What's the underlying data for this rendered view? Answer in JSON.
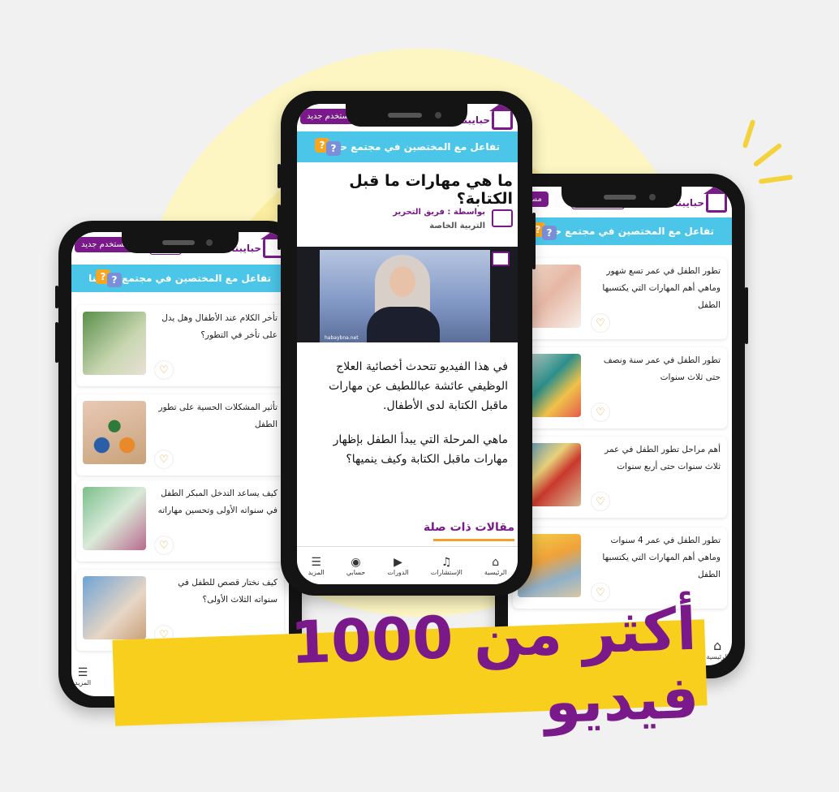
{
  "headline": "أكثر من 1000 فيديو",
  "brand": {
    "logo_text": "حبايبنا",
    "primary": "#7a1a8a",
    "accent": "#4cc6e8",
    "yellow": "#f9cf1e"
  },
  "top": {
    "new_user": "مستخدم جديد"
  },
  "banner": {
    "text": "تفاعل مع المختصين في مجتمع حبايبنا"
  },
  "left_phone": {
    "cards": [
      {
        "text": "تأخر الكلام عند الأطفال وهل يدل على تأخر في التطور؟"
      },
      {
        "text": "تأثير المشكلات الحسية على تطور الطفل"
      },
      {
        "text": "كيف يساعد التدخل المبكر الطفل في سنواته الأولى وتحسين مهاراته"
      },
      {
        "text": "كيف نختار قصص للطفل في سنواته الثلاث الأولى؟"
      }
    ],
    "nav_more": "المزيد"
  },
  "center_phone": {
    "title": "ما هي مهارات ما قبل الكتابة؟",
    "byline": "بواسطة : فريق التحرير",
    "category": "التربية الخاصة",
    "video_watermark": "habaybna.net",
    "paragraph1": "في هذا الفيديو تتحدث أخصائية العلاج الوظيفي عائشة عباللطيف عن مهارات ماقبل الكتابة لدى الأطفال.",
    "paragraph2": "ماهي المرحلة التي يبدأ الطفل بإظهار مهارات ماقبل الكتابة وكيف ينميها؟",
    "related": "مقالات ذات صلة",
    "nav": [
      "الرئيسية",
      "الإستشارات",
      "الدورات",
      "حسابي",
      "المزيد"
    ]
  },
  "right_phone": {
    "cards": [
      {
        "text": "تطور الطفل في عمر تسع شهور وماهي أهم المهارات التي يكتسبها الطفل"
      },
      {
        "text": "تطور الطفل في عمر سنة ونصف حتى ثلاث سنوات"
      },
      {
        "text": "أهم مراحل تطور الطفل في عمر ثلاث سنوات حتى أربع سنوات"
      },
      {
        "text": "تطور الطفل في عمر 4 سنوات وماهي أهم المهارات التي يكتسبها الطفل"
      }
    ],
    "nav_home": "الرئيسية"
  }
}
